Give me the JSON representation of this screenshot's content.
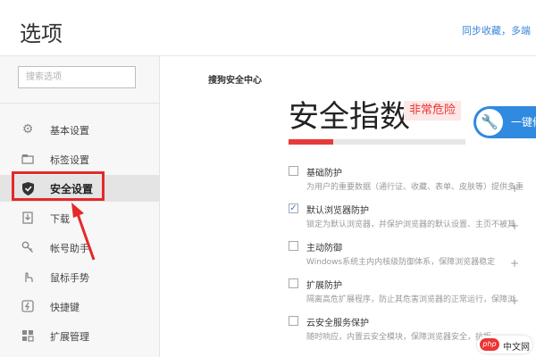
{
  "header": {
    "title": "选项",
    "sync_link": "同步收藏，多端"
  },
  "sidebar": {
    "search_placeholder": "搜索选项",
    "items": [
      {
        "label": "基本设置",
        "icon": "gear-icon",
        "active": false
      },
      {
        "label": "标签设置",
        "icon": "tab-icon",
        "active": false
      },
      {
        "label": "安全设置",
        "icon": "shield-icon",
        "active": true
      },
      {
        "label": "下载",
        "icon": "download-icon",
        "active": false
      },
      {
        "label": "帐号助手",
        "icon": "key-icon",
        "active": false
      },
      {
        "label": "鼠标手势",
        "icon": "mouse-gesture-icon",
        "active": false
      },
      {
        "label": "快捷键",
        "icon": "shortcut-icon",
        "active": false
      },
      {
        "label": "扩展管理",
        "icon": "extension-icon",
        "active": false
      }
    ]
  },
  "main": {
    "section_title": "搜狗安全中心",
    "score_heading": "安全指数",
    "danger_badge": "非常危险",
    "fix_button": "一键修复",
    "progress": 0.25,
    "colors": {
      "danger": "#e63a3a",
      "accent": "#2f8ae0"
    },
    "options": [
      {
        "title": "基础防护",
        "desc": "为用户的重要数据（通行证、收藏、表单、皮肤等）提供多重",
        "checked": false
      },
      {
        "title": "默认浏览器防护",
        "desc": "锁定为默认浏览器，并保护浏览器的默认设置、主页不被其",
        "checked": true
      },
      {
        "title": "主动防御",
        "desc": "Windows系统主内内核级防御体系，保障浏览器稳定",
        "checked": false
      },
      {
        "title": "扩展防护",
        "desc": "隔离高危扩展程序，防止其危害浏览器的正常运行，保障浏",
        "checked": false
      },
      {
        "title": "云安全服务保护",
        "desc": "随时响应，内置云安全模块，保障浏览器安全，抗拒",
        "checked": false
      }
    ]
  },
  "watermark": {
    "logo": "php",
    "text": "中文网"
  }
}
